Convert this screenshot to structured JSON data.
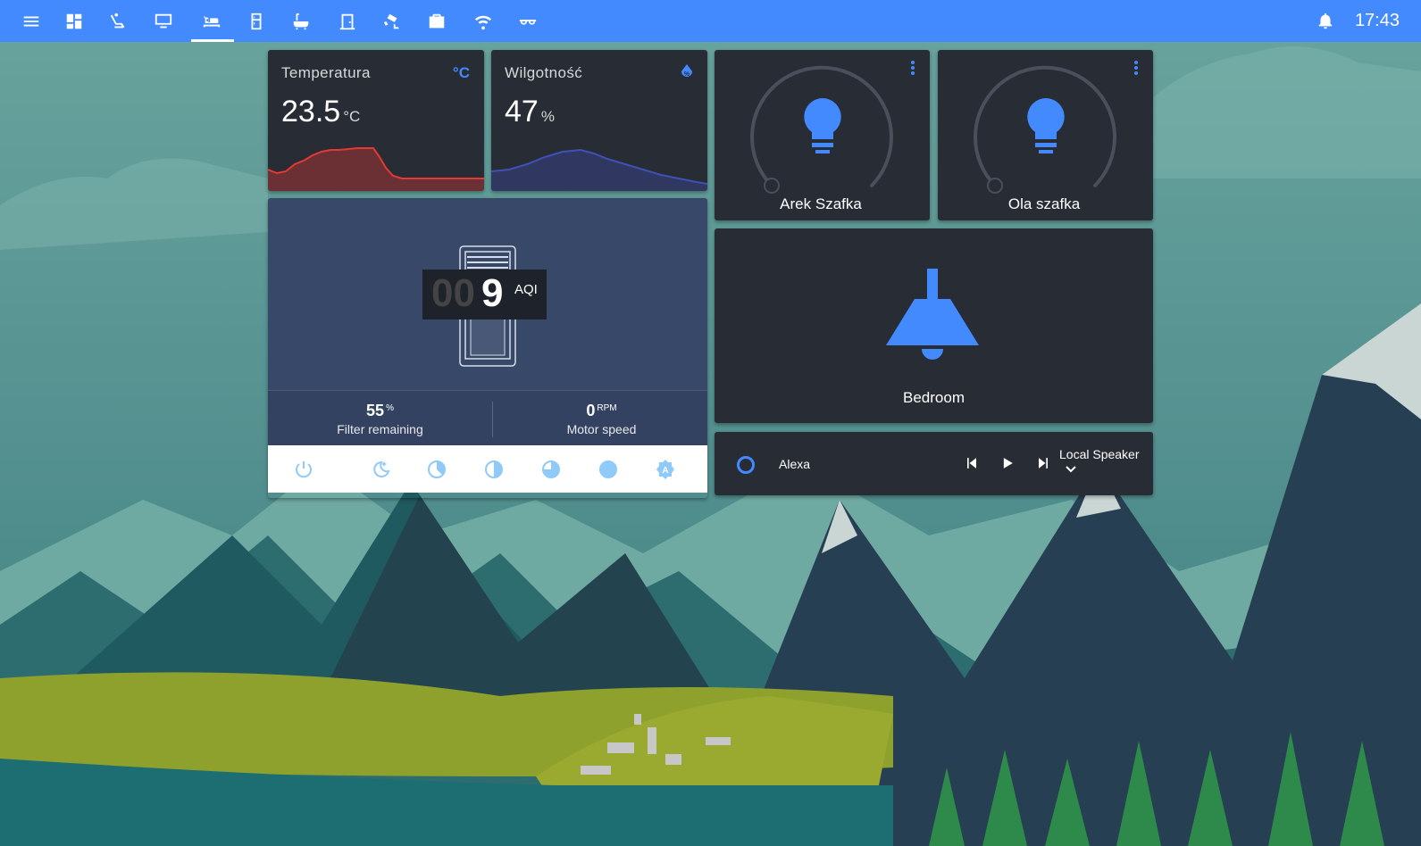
{
  "toolbar": {
    "tabs": [
      {
        "name": "menu-icon"
      },
      {
        "name": "dashboard-icon"
      },
      {
        "name": "seat-icon"
      },
      {
        "name": "desktop-icon"
      },
      {
        "name": "bed-icon",
        "active": true
      },
      {
        "name": "fridge-icon"
      },
      {
        "name": "bathtub-icon"
      },
      {
        "name": "door-icon"
      },
      {
        "name": "cctv-icon"
      },
      {
        "name": "briefcase-icon"
      },
      {
        "name": "wifi-icon"
      },
      {
        "name": "glasses-icon"
      }
    ],
    "time": "17:43",
    "accent_color": "#448aff"
  },
  "sensors": {
    "temperature": {
      "name": "Temperatura",
      "value": "23.5",
      "unit": "°C",
      "icon": "°C",
      "line_color": "#e53935"
    },
    "humidity": {
      "name": "Wilgotność",
      "value": "47",
      "unit": "%",
      "icon": "water-percent-icon",
      "line_color": "#3f51b5"
    }
  },
  "purifier": {
    "aqi_dim": "00",
    "aqi_value": "9",
    "aqi_label": "AQI",
    "filter_value": "55",
    "filter_unit": "%",
    "filter_label": "Filter remaining",
    "motor_value": "0",
    "motor_unit": "RPM",
    "motor_label": "Motor speed",
    "modes": [
      "power-icon",
      "night-mode-icon",
      "speed-low-icon",
      "speed-medium-icon",
      "speed-high-icon",
      "speed-max-icon",
      "auto-mode-icon"
    ]
  },
  "lights": [
    {
      "name": "Arek Szafka",
      "icon": "lightbulb-icon"
    },
    {
      "name": "Ola szafka",
      "icon": "lightbulb-icon"
    }
  ],
  "room_light": {
    "name": "Bedroom",
    "icon": "ceiling-lamp-icon"
  },
  "media": {
    "source": "Alexa",
    "output": "Local Speaker",
    "controls": [
      "previous-icon",
      "play-icon",
      "next-icon"
    ]
  }
}
